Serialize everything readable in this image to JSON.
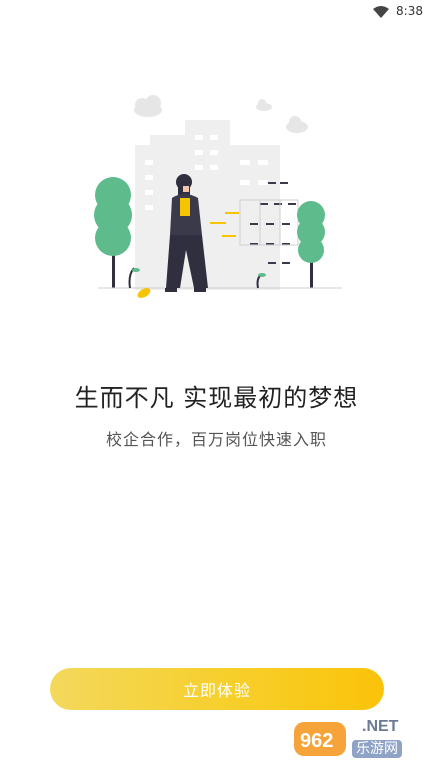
{
  "status_bar": {
    "time": "8:38",
    "icons": [
      "wifi-icon"
    ]
  },
  "onboarding": {
    "illustration": "person-in-front-of-building-illustration",
    "headline": "生而不凡 实现最初的梦想",
    "subline": "校企合作，百万岗位快速入职"
  },
  "cta": {
    "label": "立即体验"
  },
  "watermark": {
    "logo_text": "962",
    "net_text": ".NET",
    "cn_text": "乐游网"
  },
  "colors": {
    "accent_start": "#f3d85c",
    "accent_end": "#fbc30a",
    "tree_green": "#5dbb8c",
    "building_gray": "#ededed"
  }
}
